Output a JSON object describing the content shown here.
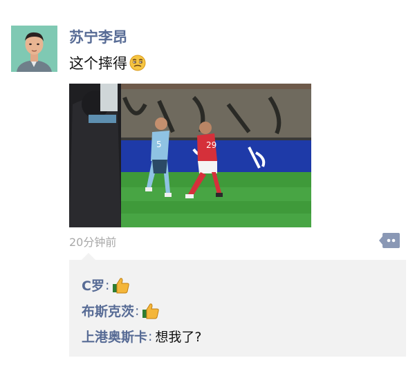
{
  "post": {
    "username": "苏宁李昂",
    "text": "这个摔得",
    "text_emoji": "smirk-face-emoji",
    "timestamp": "20分钟前",
    "image": {
      "description_icon": "soccer-match-photo"
    }
  },
  "comments": [
    {
      "author": "C罗",
      "separator": ":",
      "text": "",
      "emoji": "thumbs-up-emoji"
    },
    {
      "author": "布斯克茨",
      "separator": ":",
      "text": "",
      "emoji": "thumbs-up-emoji"
    },
    {
      "author": "上港奥斯卡",
      "separator": ":",
      "text": "想我了?",
      "emoji": ""
    }
  ],
  "colors": {
    "name_blue": "#576b95",
    "timestamp_gray": "#a8a8a8",
    "comment_bg": "#f2f2f2"
  }
}
